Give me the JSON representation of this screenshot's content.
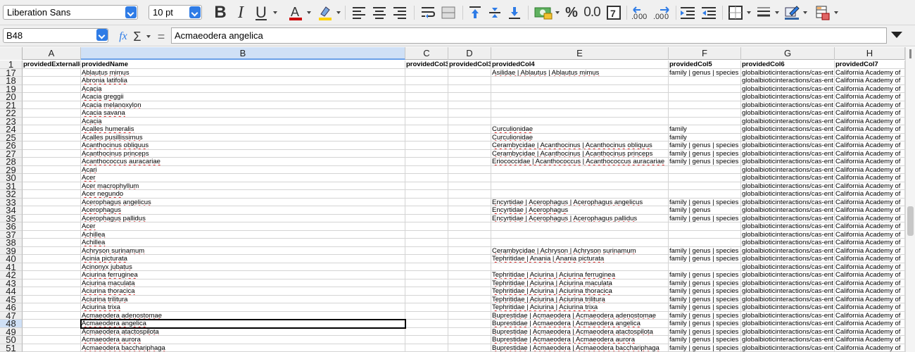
{
  "toolbar": {
    "font_name": "Liberation Sans",
    "font_size": "10 pt",
    "percent_label": "%",
    "decimal_label": "0.0",
    "colors": {
      "font_color": "#cc0000",
      "highlight": "#ffd200",
      "accent": "#2f7ce6"
    }
  },
  "formula_bar": {
    "cell_ref": "B48",
    "fx": "fx",
    "sigma": "Σ",
    "equals": "=",
    "content": "Acmaeodera angelica"
  },
  "columns": [
    "A",
    "B",
    "C",
    "D",
    "E",
    "F",
    "G",
    "H"
  ],
  "selected_column": "B",
  "header_row": {
    "num": "1",
    "cells": [
      "providedExternalId",
      "providedName",
      "providedCol3",
      "providedCol3",
      "providedCol4",
      "providedCol5",
      "providedCol6",
      "providedCol7"
    ]
  },
  "rows": [
    {
      "num": "17",
      "b": "Ablautus mimus",
      "e": "Asilidae | Ablautus | Ablautus mimus",
      "f": "family | genus | species",
      "g": "globalbioticinteractions/cas-ent",
      "h": "California Academy of"
    },
    {
      "num": "18",
      "b": "Abronia latifolia",
      "e": "",
      "f": "",
      "g": "globalbioticinteractions/cas-ent",
      "h": "California Academy of"
    },
    {
      "num": "19",
      "b": "Acacia",
      "e": "",
      "f": "",
      "g": "globalbioticinteractions/cas-ent",
      "h": "California Academy of"
    },
    {
      "num": "20",
      "b": "Acacia greggii",
      "e": "",
      "f": "",
      "g": "globalbioticinteractions/cas-ent",
      "h": "California Academy of"
    },
    {
      "num": "21",
      "b": "Acacia melanoxylon",
      "e": "",
      "f": "",
      "g": "globalbioticinteractions/cas-ent",
      "h": "California Academy of"
    },
    {
      "num": "22",
      "b": "Acacia savana",
      "e": "",
      "f": "",
      "g": "globalbioticinteractions/cas-ent",
      "h": "California Academy of"
    },
    {
      "num": "23",
      "b": "Acacia",
      "e": "",
      "f": "",
      "g": "globalbioticinteractions/cas-ent",
      "h": "California Academy of"
    },
    {
      "num": "24",
      "b": "Acalles humeralis",
      "e": "Curculionidae",
      "f": "family",
      "g": "globalbioticinteractions/cas-ent",
      "h": "California Academy of"
    },
    {
      "num": "25",
      "b": "Acalles pusillissimus",
      "e": "Curculionidae",
      "f": "family",
      "g": "globalbioticinteractions/cas-ent",
      "h": "California Academy of"
    },
    {
      "num": "26",
      "b": "Acanthocinus obliquus",
      "e": "Cerambycidae | Acanthocinus | Acanthocinus obliquus",
      "f": "family | genus | species",
      "g": "globalbioticinteractions/cas-ent",
      "h": "California Academy of"
    },
    {
      "num": "27",
      "b": "Acanthocinus princeps",
      "e": "Cerambycidae | Acanthocinus | Acanthocinus princeps",
      "f": "family | genus | species",
      "g": "globalbioticinteractions/cas-ent",
      "h": "California Academy of"
    },
    {
      "num": "28",
      "b": "Acanthococcus auracariae",
      "e": "Eriococcidae | Acanthococcus | Acanthococcus auracariae",
      "f": "family | genus | species",
      "g": "globalbioticinteractions/cas-ent",
      "h": "California Academy of"
    },
    {
      "num": "29",
      "b": "Acari",
      "e": "",
      "f": "",
      "g": "globalbioticinteractions/cas-ent",
      "h": "California Academy of"
    },
    {
      "num": "30",
      "b": "Acer",
      "e": "",
      "f": "",
      "g": "globalbioticinteractions/cas-ent",
      "h": "California Academy of"
    },
    {
      "num": "31",
      "b": "Acer macrophyllum",
      "e": "",
      "f": "",
      "g": "globalbioticinteractions/cas-ent",
      "h": "California Academy of"
    },
    {
      "num": "32",
      "b": "Acer negundo",
      "e": "",
      "f": "",
      "g": "globalbioticinteractions/cas-ent",
      "h": "California Academy of"
    },
    {
      "num": "33",
      "b": "Acerophagus angelicus",
      "e": "Encyrtidae | Acerophagus | Acerophagus angelicus",
      "f": "family | genus | species",
      "g": "globalbioticinteractions/cas-ent",
      "h": "California Academy of"
    },
    {
      "num": "34",
      "b": "Acerophagus",
      "e": "Encyrtidae | Acerophagus",
      "f": "family | genus",
      "g": "globalbioticinteractions/cas-ent",
      "h": "California Academy of"
    },
    {
      "num": "35",
      "b": "Acerophagus pallidus",
      "e": "Encyrtidae | Acerophagus | Acerophagus pallidus",
      "f": "family | genus | species",
      "g": "globalbioticinteractions/cas-ent",
      "h": "California Academy of"
    },
    {
      "num": "36",
      "b": "Acer",
      "e": "",
      "f": "",
      "g": "globalbioticinteractions/cas-ent",
      "h": "California Academy of"
    },
    {
      "num": "37",
      "b": "Achillea",
      "e": "",
      "f": "",
      "g": "globalbioticinteractions/cas-ent",
      "h": "California Academy of"
    },
    {
      "num": "38",
      "b": "Achillea",
      "e": "",
      "f": "",
      "g": "globalbioticinteractions/cas-ent",
      "h": "California Academy of"
    },
    {
      "num": "39",
      "b": "Achryson surinamum",
      "e": "Cerambycidae | Achryson | Achryson surinamum",
      "f": "family | genus | species",
      "g": "globalbioticinteractions/cas-ent",
      "h": "California Academy of"
    },
    {
      "num": "40",
      "b": "Acinia picturata",
      "e": "Tephritidae | Anania | Anania picturata",
      "f": "family | genus | species",
      "g": "globalbioticinteractions/cas-ent",
      "h": "California Academy of"
    },
    {
      "num": "41",
      "b": "Acinonyx jubatus",
      "e": "",
      "f": "",
      "g": "globalbioticinteractions/cas-ent",
      "h": "California Academy of"
    },
    {
      "num": "42",
      "b": "Aciurina ferruginea",
      "e": "Tephritidae | Aciurina | Aciurina ferruginea",
      "f": "family | genus | species",
      "g": "globalbioticinteractions/cas-ent",
      "h": "California Academy of"
    },
    {
      "num": "43",
      "b": "Aciurina maculata",
      "e": "Tephritidae | Aciurina | Aciurina maculata",
      "f": "family | genus | species",
      "g": "globalbioticinteractions/cas-ent",
      "h": "California Academy of"
    },
    {
      "num": "44",
      "b": "Aciurina thoracica",
      "e": "Tephritidae | Aciurina | Aciurina thoracica",
      "f": "family | genus | species",
      "g": "globalbioticinteractions/cas-ent",
      "h": "California Academy of"
    },
    {
      "num": "45",
      "b": "Aciurina trilitura",
      "e": "Tephritidae | Aciurina | Aciurina trilitura",
      "f": "family | genus | species",
      "g": "globalbioticinteractions/cas-ent",
      "h": "California Academy of"
    },
    {
      "num": "46",
      "b": "Aciurina trixa",
      "e": "Tephritidae | Aciurina | Aciurina trixa",
      "f": "family | genus | species",
      "g": "globalbioticinteractions/cas-ent",
      "h": "California Academy of"
    },
    {
      "num": "47",
      "b": "Acmaeodera adenostomae",
      "e": "Buprestidae | Acmaeodera | Acmaeodera adenostomae",
      "f": "family | genus | species",
      "g": "globalbioticinteractions/cas-ent",
      "h": "California Academy of"
    },
    {
      "num": "48",
      "b": "Acmaeodera angelica",
      "e": "Buprestidae | Acmaeodera | Acmaeodera angelica",
      "f": "family | genus | species",
      "g": "globalbioticinteractions/cas-ent",
      "h": "California Academy of"
    },
    {
      "num": "49",
      "b": "Acmaeodera atactospilota",
      "e": "Buprestidae | Acmaeodera | Acmaeodera atactospilota",
      "f": "family | genus | species",
      "g": "globalbioticinteractions/cas-ent",
      "h": "California Academy of"
    },
    {
      "num": "50",
      "b": "Acmaeodera aurora",
      "e": "Buprestidae | Acmaeodera | Acmaeodera aurora",
      "f": "family | genus | species",
      "g": "globalbioticinteractions/cas-ent",
      "h": "California Academy of"
    },
    {
      "num": "51",
      "b": "Acmaeodera bacchariphaga",
      "e": "Buprestidae | Acmaeodera | Acmaeodera bacchariphaga",
      "f": "family | genus | species",
      "g": "globalbioticinteractions/cas-ent",
      "h": "California Academy of"
    }
  ],
  "active_row": "48"
}
